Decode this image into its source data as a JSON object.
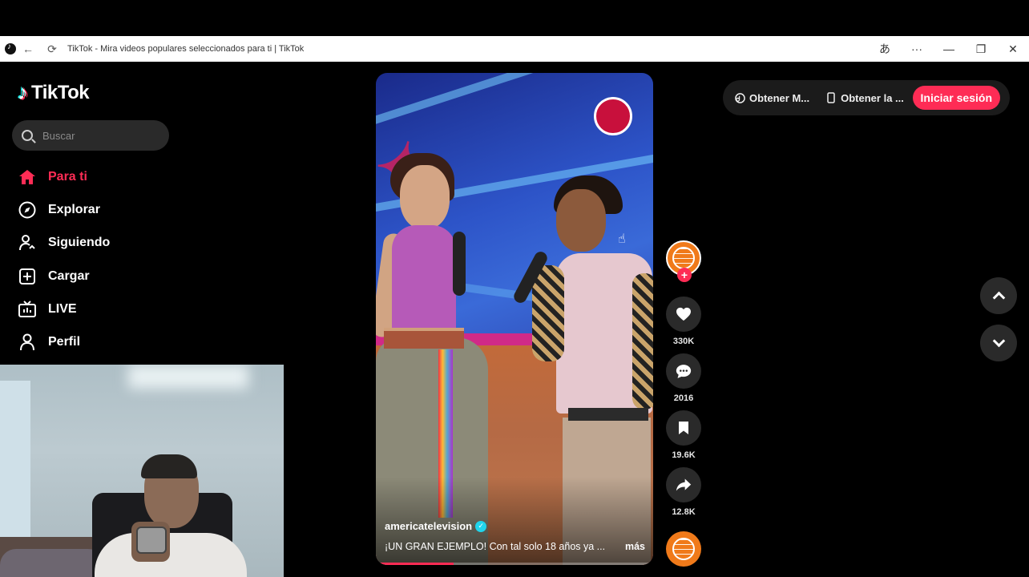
{
  "window": {
    "title": "TikTok - Mira videos populares seleccionados para ti | TikTok",
    "controls": [
      "translate",
      "more",
      "minimize",
      "restore",
      "close"
    ]
  },
  "brand": {
    "name": "TikTok"
  },
  "search": {
    "placeholder": "Buscar"
  },
  "sidebar": {
    "items": [
      {
        "label": "Para ti",
        "icon": "home-icon",
        "active": true
      },
      {
        "label": "Explorar",
        "icon": "compass-icon"
      },
      {
        "label": "Siguiendo",
        "icon": "following-icon"
      },
      {
        "label": "Cargar",
        "icon": "upload-icon"
      },
      {
        "label": "LIVE",
        "icon": "live-tv-icon"
      },
      {
        "label": "Perfil",
        "icon": "profile-icon"
      }
    ]
  },
  "topbar": {
    "get_app_label": "Obtener M...",
    "get_pc_label": "Obtener la ...",
    "login_label": "Iniciar sesión"
  },
  "video": {
    "author": "americatelevision",
    "description": "¡UN GRAN EJEMPLO! Con tal solo 18 años ya ...",
    "more_label": "más",
    "progress": 0.28
  },
  "actions": {
    "likes": "330K",
    "comments": "2016",
    "saves": "19.6K",
    "shares": "12.8K"
  },
  "colors": {
    "accent": "#fe2c55",
    "background": "#000000",
    "panel": "#2a2a2a"
  }
}
